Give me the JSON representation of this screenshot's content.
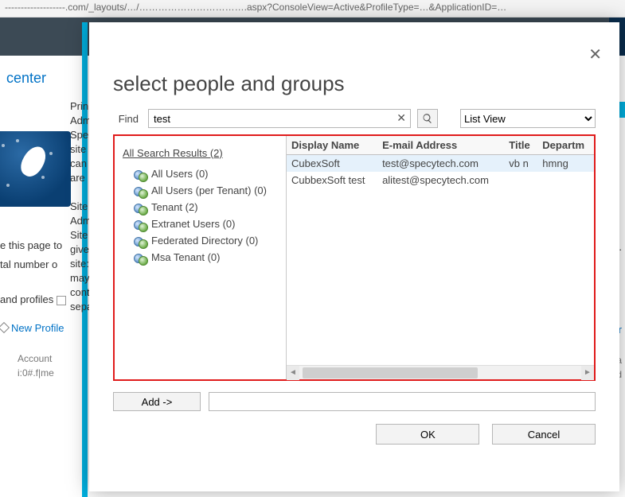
{
  "urlbar": "-------------------.com/_layouts/…/…………………………….aspx?ConsoleView=Active&ProfileType=…&ApplicationID=…",
  "background": {
    "center_link": "center",
    "left_block": "Prin\nAdm\nSpe\nsite\ncan\nare\n\nSite\nAdm\nSite\ngive\nsite:\nmay\ncont\nsepa",
    "use_page": "e this page to",
    "total_number": "tal number o",
    "and_profiles": "and profiles",
    "new_profile": "New Profile",
    "account": "Account",
    "i0f": "i:0#.f|me",
    "right_ite": "ite.",
    "right_fpr": "f pr",
    "right_ail": "ail a",
    "right_iced": "iced"
  },
  "dialog": {
    "title": "select people and groups",
    "find_label": "Find",
    "find_value": "test",
    "view_options": [
      "List View"
    ],
    "view_selected": "List View",
    "tree_root": "All Search Results (2)",
    "tree": [
      {
        "label": "All Users (0)"
      },
      {
        "label": "All Users (per Tenant) (0)"
      },
      {
        "label": "Tenant (2)"
      },
      {
        "label": "Extranet Users (0)"
      },
      {
        "label": "Federated Directory (0)"
      },
      {
        "label": "Msa Tenant (0)"
      }
    ],
    "columns": [
      "Display Name",
      "E-mail Address",
      "Title",
      "Departm"
    ],
    "rows": [
      {
        "display": "CubexSoft",
        "email": "test@specytech.com",
        "title": "vb n",
        "dept": "hmng",
        "selected": true
      },
      {
        "display": "CubbexSoft test",
        "email": "alitest@specytech.com",
        "title": "",
        "dept": "",
        "selected": false
      }
    ],
    "add_btn": "Add ->",
    "ok": "OK",
    "cancel": "Cancel"
  }
}
